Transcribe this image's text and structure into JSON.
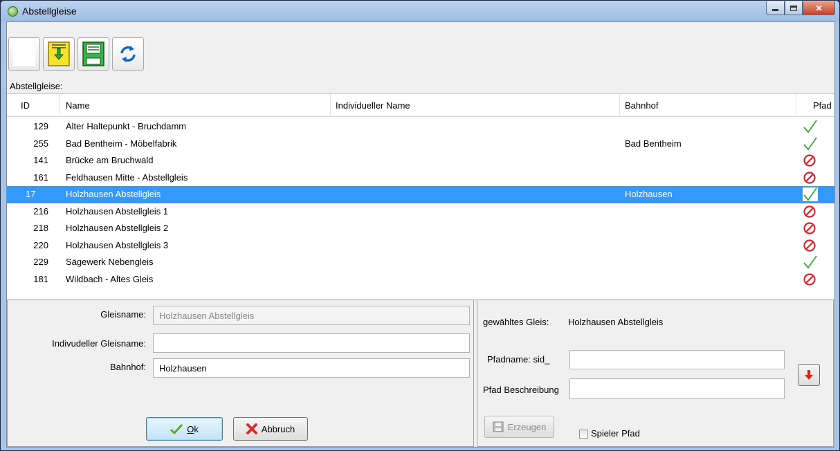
{
  "window": {
    "title": "Abstellgleise"
  },
  "list": {
    "section_label": "Abstellgleise:",
    "columns": {
      "id": "ID",
      "name": "Name",
      "individual_name": "Individueller Name",
      "bahnhof": "Bahnhof",
      "pfad": "Pfad"
    },
    "rows": [
      {
        "id": "129",
        "name": "Alter Haltepunkt - Bruchdamm",
        "individual_name": "",
        "bahnhof": "",
        "pfad": "check-icon"
      },
      {
        "id": "255",
        "name": "Bad Bentheim - Möbelfabrik",
        "individual_name": "",
        "bahnhof": "Bad Bentheim",
        "pfad": "check-icon"
      },
      {
        "id": "141",
        "name": "Brücke am Bruchwald",
        "individual_name": "",
        "bahnhof": "",
        "pfad": "prohibited-icon"
      },
      {
        "id": "161",
        "name": "Feldhausen Mitte - Abstellgleis",
        "individual_name": "",
        "bahnhof": "",
        "pfad": "prohibited-icon"
      },
      {
        "id": "17",
        "name": "Holzhausen Abstellgleis",
        "individual_name": "",
        "bahnhof": "Holzhausen",
        "pfad": "check-icon",
        "selected": true
      },
      {
        "id": "216",
        "name": "Holzhausen Abstellgleis 1",
        "individual_name": "",
        "bahnhof": "",
        "pfad": "prohibited-icon"
      },
      {
        "id": "218",
        "name": "Holzhausen Abstellgleis 2",
        "individual_name": "",
        "bahnhof": "",
        "pfad": "prohibited-icon"
      },
      {
        "id": "220",
        "name": "Holzhausen Abstellgleis 3",
        "individual_name": "",
        "bahnhof": "",
        "pfad": "prohibited-icon"
      },
      {
        "id": "229",
        "name": "Sägewerk Nebengleis",
        "individual_name": "",
        "bahnhof": "",
        "pfad": "check-icon"
      },
      {
        "id": "181",
        "name": "Wildbach - Altes Gleis",
        "individual_name": "",
        "bahnhof": "",
        "pfad": "prohibited-icon"
      }
    ]
  },
  "edit_form": {
    "gleisname_label": "Gleisname:",
    "gleisname_value": "Holzhausen Abstellgleis",
    "individual_label": "Indivudeller Gleisname:",
    "individual_value": "",
    "bahnhof_label": "Bahnhof:",
    "bahnhof_value": "Holzhausen",
    "ok_label": "Ok",
    "ok_mnemonic": "O",
    "ok_rest": "k",
    "cancel_label": "Abbruch"
  },
  "path_form": {
    "selected_label": "gewähltes Gleis:",
    "selected_value": "Holzhausen Abstellgleis",
    "pfadname_label": "Pfadname: sid_",
    "pfadname_value": "",
    "beschreibung_label": "Pfad Beschreibung",
    "beschreibung_value": "",
    "erzeugen_label": "Erzeugen",
    "spieler_label": "Spieler Pfad",
    "spieler_checked": false
  },
  "toolbar": {
    "buttons": [
      "blank-icon",
      "import-icon",
      "save-icon",
      "refresh-icon"
    ]
  },
  "colors": {
    "selection": "#3399ff",
    "check": "#3aa83a",
    "prohibited": "#d8232a",
    "titlebar": "#a9c4e6"
  }
}
